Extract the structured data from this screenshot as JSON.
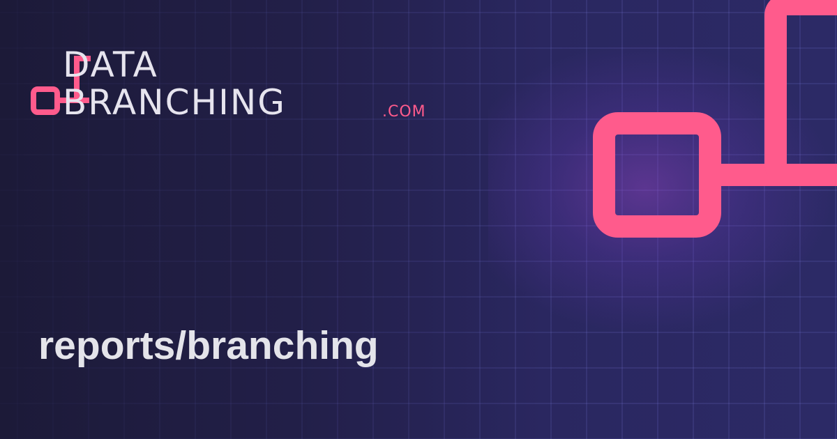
{
  "brand": {
    "line1": "DATA",
    "line2": "BRANCHING",
    "suffix": ".COM"
  },
  "path": "reports/branching",
  "colors": {
    "accent": "#ff5b8c",
    "background": "#221f48",
    "text": "#e4e4ea"
  },
  "icons": {
    "logo": "branch-node-icon",
    "decoration": "branch-node-icon"
  }
}
